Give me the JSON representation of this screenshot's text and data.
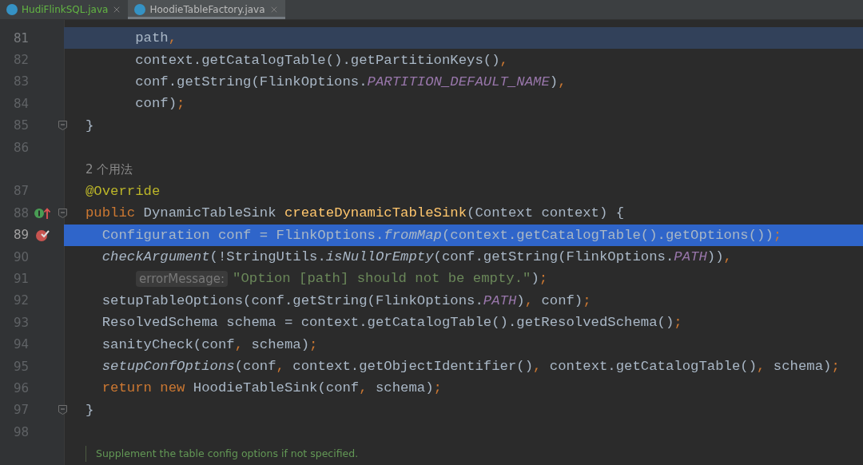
{
  "tabs": [
    {
      "label": "HudiFlinkSQL.java",
      "selected": false,
      "color": "#62b543"
    },
    {
      "label": "HoodieTableFactory.java",
      "selected": true,
      "color": "#bbbbbb"
    }
  ],
  "lines": [
    {
      "kind": "code",
      "number": "81",
      "highlighted": true,
      "selected": false,
      "fold": false,
      "override": false,
      "breakpoint": false,
      "wrapped": false,
      "tokens": [
        {
          "kind": "plain",
          "text": "      path"
        },
        {
          "kind": "punct",
          "text": ","
        }
      ]
    },
    {
      "kind": "code",
      "number": "82",
      "highlighted": false,
      "selected": false,
      "fold": false,
      "override": false,
      "breakpoint": false,
      "wrapped": false,
      "tokens": [
        {
          "kind": "plain",
          "text": "      context.getCatalogTable().getPartitionKeys()"
        },
        {
          "kind": "punct",
          "text": ","
        }
      ]
    },
    {
      "kind": "code",
      "number": "83",
      "highlighted": false,
      "selected": false,
      "fold": false,
      "override": false,
      "breakpoint": false,
      "wrapped": false,
      "tokens": [
        {
          "kind": "plain",
          "text": "      conf.getString(FlinkOptions."
        },
        {
          "kind": "const",
          "text": "PARTITION_DEFAULT_NAME"
        },
        {
          "kind": "plain",
          "text": ")"
        },
        {
          "kind": "punct",
          "text": ","
        }
      ]
    },
    {
      "kind": "code",
      "number": "84",
      "highlighted": false,
      "selected": false,
      "fold": false,
      "override": false,
      "breakpoint": false,
      "wrapped": false,
      "tokens": [
        {
          "kind": "plain",
          "text": "      conf)"
        },
        {
          "kind": "punct",
          "text": ";"
        }
      ]
    },
    {
      "kind": "code",
      "number": "85",
      "highlighted": false,
      "selected": false,
      "fold": true,
      "override": false,
      "breakpoint": false,
      "wrapped": false,
      "tokens": [
        {
          "kind": "plain",
          "text": "}"
        }
      ]
    },
    {
      "kind": "code",
      "number": "86",
      "highlighted": false,
      "selected": false,
      "fold": false,
      "override": false,
      "breakpoint": false
    },
    {
      "kind": "usages",
      "text": "2 个用法"
    },
    {
      "kind": "code",
      "number": "87",
      "highlighted": false,
      "selected": false,
      "fold": false,
      "override": false,
      "breakpoint": false,
      "wrapped": false,
      "tokens": [
        {
          "kind": "annot",
          "text": "@Override"
        }
      ]
    },
    {
      "kind": "code",
      "number": "88",
      "highlighted": false,
      "selected": false,
      "fold": true,
      "override": true,
      "breakpoint": false,
      "wrapped": false,
      "tokens": [
        {
          "kind": "kw",
          "text": "public "
        },
        {
          "kind": "plain",
          "text": "DynamicTableSink "
        },
        {
          "kind": "decl",
          "text": "createDynamicTableSink"
        },
        {
          "kind": "plain",
          "text": "(Context context) {"
        }
      ]
    },
    {
      "kind": "code",
      "number": "89",
      "highlighted": false,
      "selected": true,
      "fold": false,
      "override": false,
      "breakpoint": true,
      "wrapped": false,
      "tokens": [
        {
          "kind": "plain",
          "text": "  Configuration conf = FlinkOptions."
        },
        {
          "kind": "static",
          "text": "fromMap"
        },
        {
          "kind": "plain",
          "text": "(context.getCatalogTable().getOptions())"
        },
        {
          "kind": "punct",
          "text": ";"
        }
      ]
    },
    {
      "kind": "code",
      "number": "90",
      "highlighted": false,
      "selected": false,
      "fold": false,
      "override": false,
      "breakpoint": false,
      "wrapped": false,
      "tokens": [
        {
          "kind": "static",
          "text": "  checkArgument"
        },
        {
          "kind": "plain",
          "text": "(!StringUtils."
        },
        {
          "kind": "static",
          "text": "isNullOrEmpty"
        },
        {
          "kind": "plain",
          "text": "(conf.getString(FlinkOptions."
        },
        {
          "kind": "const",
          "text": "PATH"
        },
        {
          "kind": "plain",
          "text": "))"
        },
        {
          "kind": "punct",
          "text": ","
        }
      ]
    },
    {
      "kind": "code",
      "number": "91",
      "highlighted": false,
      "selected": false,
      "fold": false,
      "override": false,
      "breakpoint": false,
      "wrapped": true,
      "tokens": [
        {
          "kind": "hint",
          "text": "errorMessage:"
        },
        {
          "kind": "str",
          "text": "\"Option [path] should not be empty.\""
        },
        {
          "kind": "plain",
          "text": ")"
        },
        {
          "kind": "punct",
          "text": ";"
        }
      ]
    },
    {
      "kind": "code",
      "number": "92",
      "highlighted": false,
      "selected": false,
      "fold": false,
      "override": false,
      "breakpoint": false,
      "wrapped": false,
      "tokens": [
        {
          "kind": "plain",
          "text": "  setupTableOptions(conf.getString(FlinkOptions."
        },
        {
          "kind": "const",
          "text": "PATH"
        },
        {
          "kind": "plain",
          "text": ")"
        },
        {
          "kind": "punct",
          "text": ","
        },
        {
          "kind": "plain",
          "text": " conf)"
        },
        {
          "kind": "punct",
          "text": ";"
        }
      ]
    },
    {
      "kind": "code",
      "number": "93",
      "highlighted": false,
      "selected": false,
      "fold": false,
      "override": false,
      "breakpoint": false,
      "wrapped": false,
      "tokens": [
        {
          "kind": "plain",
          "text": "  ResolvedSchema schema = context.getCatalogTable().getResolvedSchema()"
        },
        {
          "kind": "punct",
          "text": ";"
        }
      ]
    },
    {
      "kind": "code",
      "number": "94",
      "highlighted": false,
      "selected": false,
      "fold": false,
      "override": false,
      "breakpoint": false,
      "wrapped": false,
      "tokens": [
        {
          "kind": "plain",
          "text": "  sanityCheck(conf"
        },
        {
          "kind": "punct",
          "text": ","
        },
        {
          "kind": "plain",
          "text": " schema)"
        },
        {
          "kind": "punct",
          "text": ";"
        }
      ]
    },
    {
      "kind": "code",
      "number": "95",
      "highlighted": false,
      "selected": false,
      "fold": false,
      "override": false,
      "breakpoint": false,
      "wrapped": false,
      "tokens": [
        {
          "kind": "static",
          "text": "  setupConfOptions"
        },
        {
          "kind": "plain",
          "text": "(conf"
        },
        {
          "kind": "punct",
          "text": ","
        },
        {
          "kind": "plain",
          "text": " context.getObjectIdentifier()"
        },
        {
          "kind": "punct",
          "text": ","
        },
        {
          "kind": "plain",
          "text": " context.getCatalogTable()"
        },
        {
          "kind": "punct",
          "text": ","
        },
        {
          "kind": "plain",
          "text": " schema)"
        },
        {
          "kind": "punct",
          "text": ";"
        }
      ]
    },
    {
      "kind": "code",
      "number": "96",
      "highlighted": false,
      "selected": false,
      "fold": false,
      "override": false,
      "breakpoint": false,
      "wrapped": false,
      "tokens": [
        {
          "kind": "kw",
          "text": "  return new "
        },
        {
          "kind": "plain",
          "text": "HoodieTableSink(conf"
        },
        {
          "kind": "punct",
          "text": ","
        },
        {
          "kind": "plain",
          "text": " schema)"
        },
        {
          "kind": "punct",
          "text": ";"
        }
      ]
    },
    {
      "kind": "code",
      "number": "97",
      "highlighted": false,
      "selected": false,
      "fold": true,
      "override": false,
      "breakpoint": false,
      "wrapped": false,
      "tokens": [
        {
          "kind": "plain",
          "text": "}"
        }
      ]
    },
    {
      "kind": "code",
      "number": "98",
      "highlighted": false,
      "selected": false,
      "fold": false,
      "override": false,
      "breakpoint": false
    },
    {
      "kind": "doc",
      "text": "Supplement the table config options if not specified."
    }
  ]
}
